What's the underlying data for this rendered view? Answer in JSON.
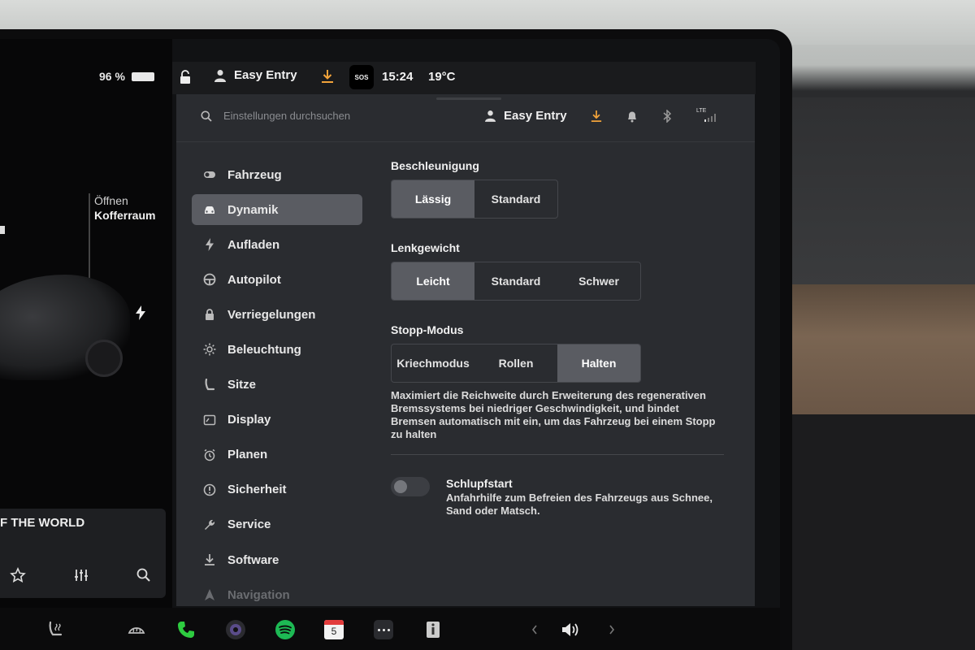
{
  "status": {
    "battery": "96 %",
    "profile": "Easy Entry",
    "sos": "SOS",
    "time": "15:24",
    "temperature": "19°C"
  },
  "car_panel": {
    "trunk_line1": "Öffnen",
    "trunk_line2": "Kofferraum",
    "media_title": "F THE WORLD"
  },
  "topbar": {
    "search_placeholder": "Einstellungen durchsuchen",
    "profile": "Easy Entry",
    "lte": "LTE"
  },
  "nav": [
    {
      "label": "Fahrzeug",
      "icon": "toggle-icon"
    },
    {
      "label": "Dynamik",
      "icon": "car-icon",
      "active": true
    },
    {
      "label": "Aufladen",
      "icon": "lightning-icon"
    },
    {
      "label": "Autopilot",
      "icon": "steering-wheel-icon"
    },
    {
      "label": "Verriegelungen",
      "icon": "lock-icon"
    },
    {
      "label": "Beleuchtung",
      "icon": "sun-icon"
    },
    {
      "label": "Sitze",
      "icon": "seat-icon"
    },
    {
      "label": "Display",
      "icon": "display-icon"
    },
    {
      "label": "Planen",
      "icon": "alarm-icon"
    },
    {
      "label": "Sicherheit",
      "icon": "alert-icon"
    },
    {
      "label": "Service",
      "icon": "wrench-icon"
    },
    {
      "label": "Software",
      "icon": "download-icon"
    },
    {
      "label": "Navigation",
      "icon": "navigation-icon"
    }
  ],
  "acceleration": {
    "title": "Beschleunigung",
    "options": [
      "Lässig",
      "Standard"
    ],
    "selected": "Lässig"
  },
  "steering": {
    "title": "Lenkgewicht",
    "options": [
      "Leicht",
      "Standard",
      "Schwer"
    ],
    "selected": "Leicht"
  },
  "stop_mode": {
    "title": "Stopp-Modus",
    "options": [
      "Kriechmodus",
      "Rollen",
      "Halten"
    ],
    "selected": "Halten",
    "description": "Maximiert die Reichweite durch Erweiterung des regenerativen Bremssystems bei niedriger Geschwindigkeit, und bindet Bremsen automatisch mit ein, um das Fahrzeug bei einem Stopp zu halten"
  },
  "slip_start": {
    "title": "Schlupfstart",
    "description": "Anfahrhilfe zum Befreien des Fahrzeugs aus Schnee, Sand oder Matsch.",
    "enabled": false
  },
  "dock": {
    "calendar_day": "5"
  },
  "colors": {
    "accent_orange": "#f2a33a",
    "phone_green": "#2ecc40",
    "spotify_green": "#1db954",
    "calendar_red": "#e23b3b"
  }
}
